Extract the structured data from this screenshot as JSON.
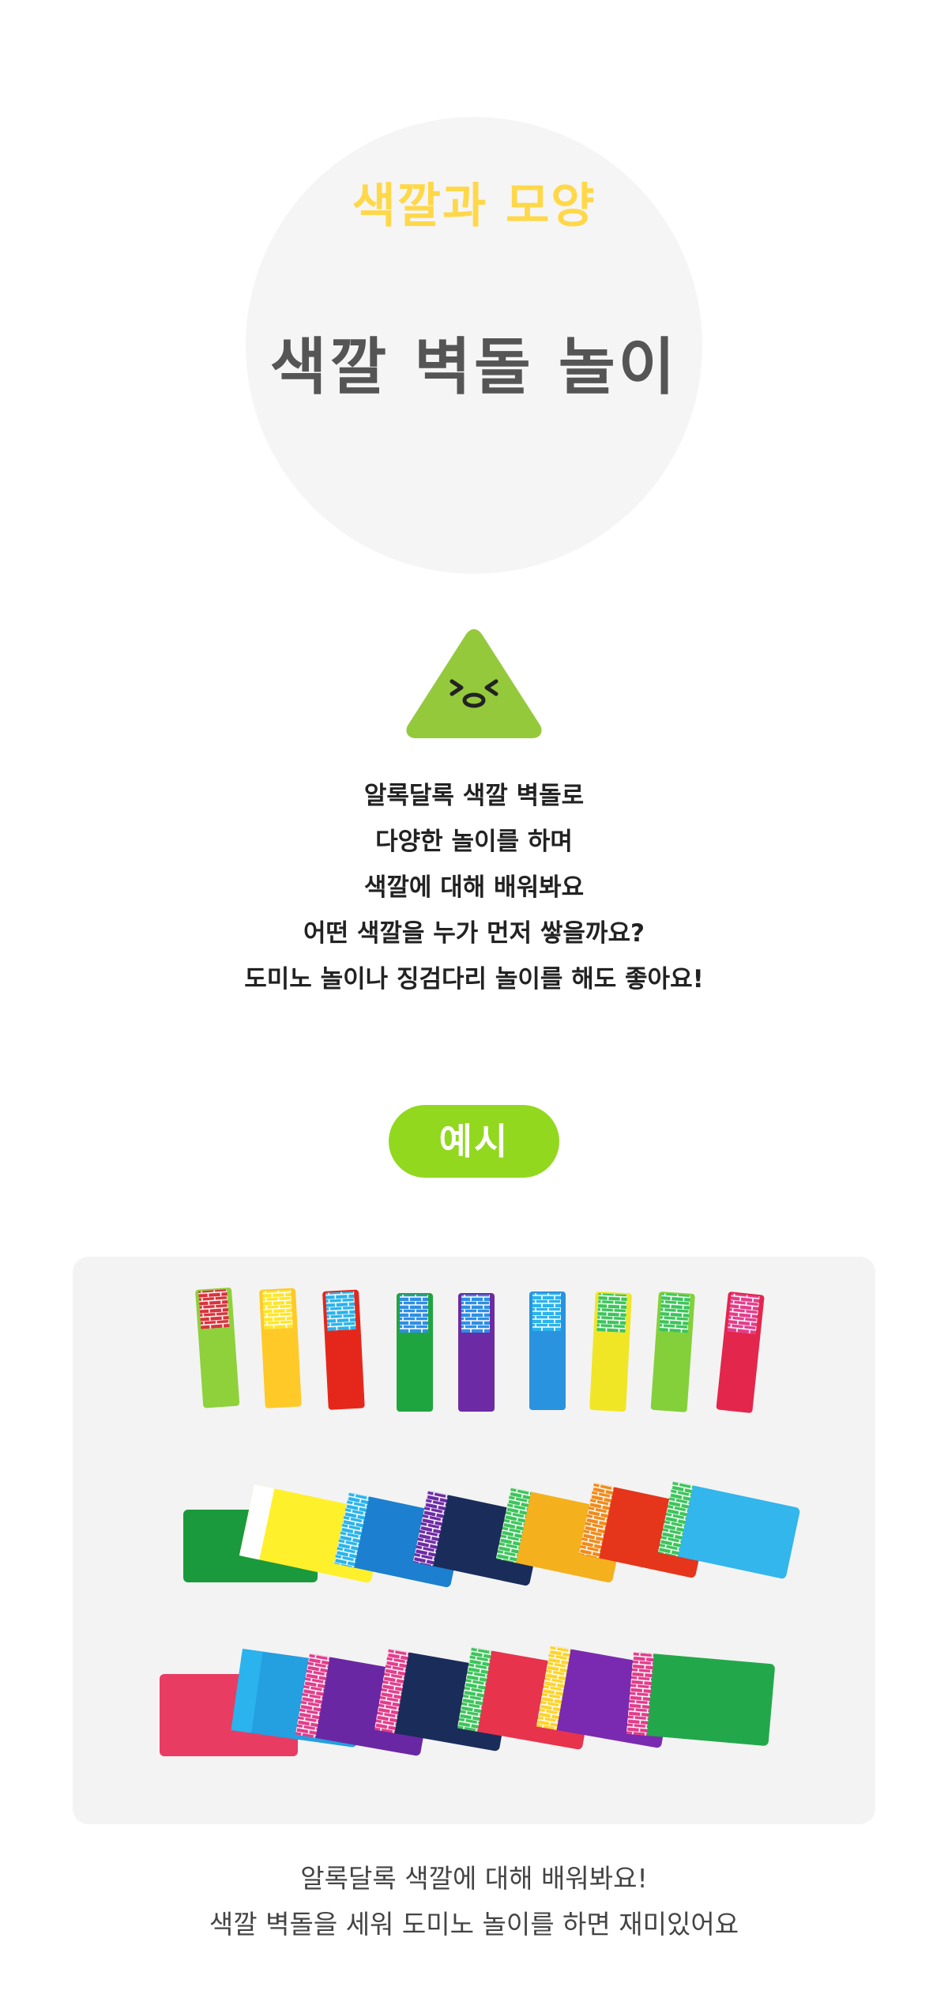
{
  "hero": {
    "subtitle": "색깔과 모양",
    "title": "색깔 벽돌 놀이"
  },
  "mascot": {
    "icon": "triangle-face-icon",
    "color": "#94c93c"
  },
  "description": {
    "lines": [
      "알록달록 색깔 벽돌로",
      "다양한 놀이를 하며",
      "색깔에 대해 배워봐요",
      "어떤 색깔을 누가 먼저 쌓을까요?",
      "도미노 놀이나 징검다리 놀이를 해도 좋아요!"
    ]
  },
  "example_label": "예시",
  "caption": {
    "lines": [
      "알록달록 색깔에 대해 배워봐요!",
      "색깔 벽돌을 세워 도미노 놀이를 하면 재미있어요"
    ]
  },
  "colors": {
    "accent_yellow": "#ffd84a",
    "pill_green": "#92d81f",
    "title_gray": "#555555"
  }
}
